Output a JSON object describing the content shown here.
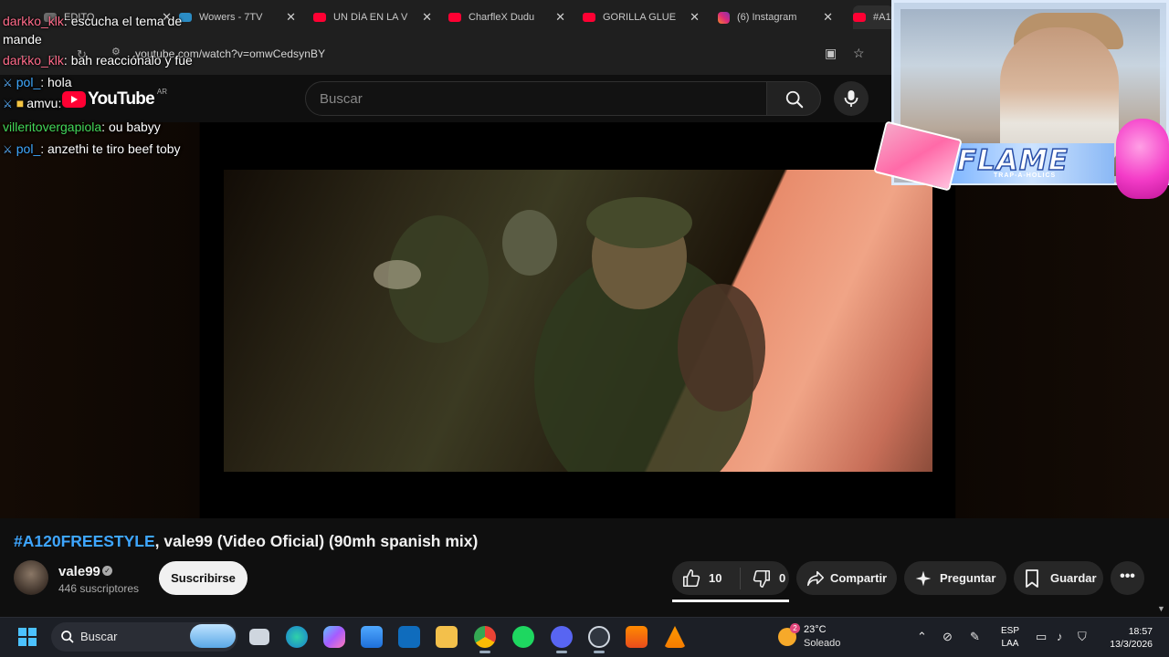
{
  "browser": {
    "tabs": [
      {
        "title": "EDITO",
        "favicon": "generic-favicon"
      },
      {
        "title": "Wowers - 7TV",
        "favicon": "7tv-favicon"
      },
      {
        "title": "UN DÍA EN LA V",
        "favicon": "youtube-favicon"
      },
      {
        "title": "CharfleX Dudu",
        "favicon": "youtube-favicon"
      },
      {
        "title": "GORILLA GLUE",
        "favicon": "youtube-favicon"
      },
      {
        "title": "(6) Instagram",
        "favicon": "instagram-favicon"
      },
      {
        "title": "#A1",
        "favicon": "youtube-favicon"
      }
    ],
    "close_glyph": "✕",
    "url": "youtube.com/watch?v=omwCedsynBY"
  },
  "youtube": {
    "logo_text": "YouTube",
    "logo_country": "AR",
    "search_placeholder": "Buscar",
    "video": {
      "title_tag": "#A120FREESTYLE",
      "title_rest": ", vale99 (Video Oficial) (90mh spanish mix)",
      "channel_name": "vale99",
      "subscribers": "446 suscriptores",
      "subscribe_label": "Suscribirse",
      "likes": "10",
      "dislikes": "0",
      "share_label": "Compartir",
      "ask_label": "Preguntar",
      "save_label": "Guardar",
      "more_glyph": "•••"
    }
  },
  "chat": [
    {
      "user": "darkko_klk",
      "text": ": escucha el tema de",
      "color": "#ff6b8a",
      "badge": false
    },
    {
      "user": "",
      "text": "mande",
      "color": "#ffffff",
      "badge": false
    },
    {
      "user": "darkko_klk",
      "text": ": bah reacciónalo y fue",
      "color": "#ff6b8a",
      "badge": false
    },
    {
      "user": "pol_",
      "text": ": hola",
      "color": "#3fa9ff",
      "badge": true
    },
    {
      "user": "amvu",
      "text": ":",
      "color": "#ffffff",
      "badge": true
    },
    {
      "user": "villeritovergapiola",
      "text": ": ou babyy",
      "color": "#43d85a",
      "badge": false
    },
    {
      "user": "pol_",
      "text": ": anzethi te tiro beef toby",
      "color": "#3fa9ff",
      "badge": true
    }
  ],
  "overlay": {
    "flame_text": "FLAME",
    "flame_sub": "TRAP-A-HOLICS"
  },
  "taskbar": {
    "search_label": "Buscar",
    "weather_temp": "23°C",
    "weather_cond": "Soleado",
    "weather_badge": "2",
    "lang_top": "ESP",
    "lang_bottom": "LAA",
    "time": "18:57",
    "date": "13/3/2026"
  },
  "colors": {
    "accent_blue": "#3ea6ff",
    "youtube_red": "#ff0033"
  }
}
